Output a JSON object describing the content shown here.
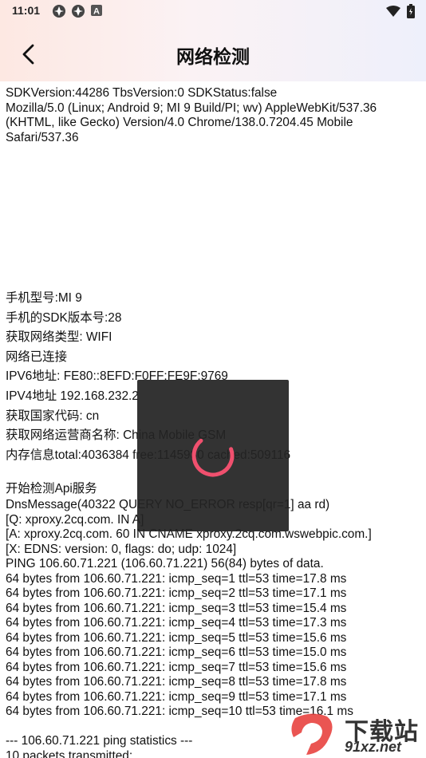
{
  "status_bar": {
    "time": "11:01",
    "left_icons": [
      "app-notification-icon",
      "app-notification-icon",
      "a-box-icon"
    ],
    "right_icons": [
      "wifi-icon",
      "battery-icon"
    ]
  },
  "nav": {
    "title": "网络检测",
    "back_icon": "chevron-left-icon"
  },
  "info": {
    "sdk_line": "SDKVersion:44286 TbsVersion:0 SDKStatus:false",
    "user_agent": "Mozilla/5.0 (Linux; Android 9; MI 9 Build/PI; wv) AppleWebKit/537.36 (KHTML, like Gecko) Version/4.0 Chrome/138.0.7204.45 Mobile Safari/537.36"
  },
  "device": [
    "手机型号:MI 9",
    "手机的SDK版本号:28",
    "获取网络类型: WIFI",
    "网络已连接",
    "IPV6地址: FE80::8EFD:F0FF:FE9F:9769",
    "IPV4地址 192.168.232.2",
    "获取国家代码: cn",
    "获取网络运营商名称: China Mobile GSM",
    "内存信息total:4036384 free:1145980 cached:509116"
  ],
  "log": {
    "heading": "开始检测Api服务",
    "lines": [
      "DnsMessage(40322 QUERY NO_ERROR resp[qr=1] aa rd)",
      "[Q: xproxy.2cq.com.  IN    A]",
      "[A: xproxy.2cq.com.  60   IN    CNAME xproxy.2cq.com.wswebpic.com.]",
      "[X: EDNS: version: 0, flags: do; udp: 1024]",
      "PING 106.60.71.221 (106.60.71.221) 56(84) bytes of data.",
      "64 bytes from 106.60.71.221: icmp_seq=1 ttl=53 time=17.8 ms",
      "64 bytes from 106.60.71.221: icmp_seq=2 ttl=53 time=17.1 ms",
      "64 bytes from 106.60.71.221: icmp_seq=3 ttl=53 time=15.4 ms",
      "64 bytes from 106.60.71.221: icmp_seq=4 ttl=53 time=17.3 ms",
      "64 bytes from 106.60.71.221: icmp_seq=5 ttl=53 time=15.6 ms",
      "64 bytes from 106.60.71.221: icmp_seq=6 ttl=53 time=15.0 ms",
      "64 bytes from 106.60.71.221: icmp_seq=7 ttl=53 time=15.6 ms",
      "64 bytes from 106.60.71.221: icmp_seq=8 ttl=53 time=17.8 ms",
      "64 bytes from 106.60.71.221: icmp_seq=9 ttl=53 time=17.1 ms",
      "64 bytes from 106.60.71.221: icmp_seq=10 ttl=53 time=16.1 ms"
    ]
  },
  "stats": {
    "title": "--- 106.60.71.221 ping statistics ---",
    "transmitted": "10 packets transmitted;"
  },
  "loading": {
    "spinner_color": "#f0506e"
  },
  "watermark": {
    "top_text": "下载站",
    "bottom_text": "91xz.net",
    "brand_color": "#e8423f"
  }
}
